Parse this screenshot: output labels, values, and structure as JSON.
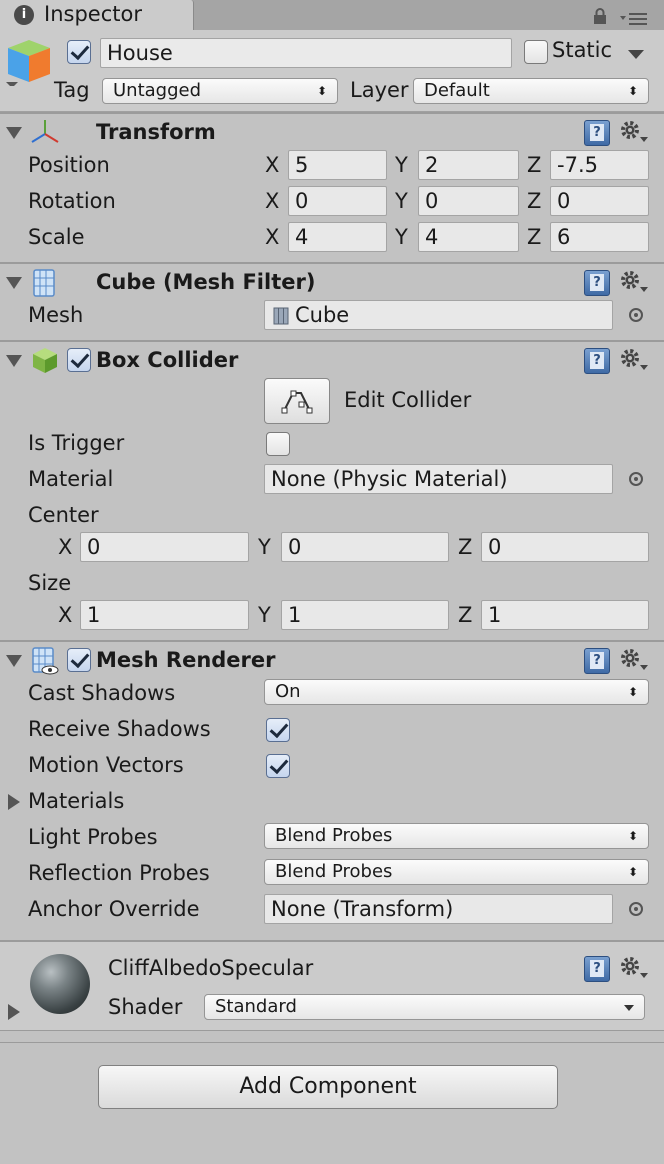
{
  "window": {
    "tab_title": "Inspector"
  },
  "object": {
    "name": "House",
    "active": true,
    "static_label": "Static",
    "static_checked": false,
    "tag_label": "Tag",
    "tag_value": "Untagged",
    "layer_label": "Layer",
    "layer_value": "Default"
  },
  "transform": {
    "title": "Transform",
    "position": {
      "label": "Position",
      "x": "5",
      "y": "2",
      "z": "-7.5"
    },
    "rotation": {
      "label": "Rotation",
      "x": "0",
      "y": "0",
      "z": "0"
    },
    "scale": {
      "label": "Scale",
      "x": "4",
      "y": "4",
      "z": "6"
    },
    "axes": {
      "x": "X",
      "y": "Y",
      "z": "Z"
    }
  },
  "mesh_filter": {
    "title": "Cube (Mesh Filter)",
    "mesh_label": "Mesh",
    "mesh_value": "Cube"
  },
  "box_collider": {
    "title": "Box Collider",
    "enabled": true,
    "edit_label": "Edit Collider",
    "is_trigger_label": "Is Trigger",
    "is_trigger": false,
    "material_label": "Material",
    "material_value": "None (Physic Material)",
    "center_label": "Center",
    "center": {
      "x": "0",
      "y": "0",
      "z": "0"
    },
    "size_label": "Size",
    "size": {
      "x": "1",
      "y": "1",
      "z": "1"
    }
  },
  "mesh_renderer": {
    "title": "Mesh Renderer",
    "enabled": true,
    "cast_shadows_label": "Cast Shadows",
    "cast_shadows_value": "On",
    "receive_shadows_label": "Receive Shadows",
    "receive_shadows": true,
    "motion_vectors_label": "Motion Vectors",
    "motion_vectors": true,
    "materials_label": "Materials",
    "light_probes_label": "Light Probes",
    "light_probes_value": "Blend Probes",
    "reflection_probes_label": "Reflection Probes",
    "reflection_probes_value": "Blend Probes",
    "anchor_override_label": "Anchor Override",
    "anchor_override_value": "None (Transform)"
  },
  "material": {
    "name": "CliffAlbedoSpecular",
    "shader_label": "Shader",
    "shader_value": "Standard"
  },
  "add_component_label": "Add Component",
  "icons": {
    "arrows": {
      "down": "▼",
      "right": "▶",
      "updown": "⬍"
    }
  }
}
